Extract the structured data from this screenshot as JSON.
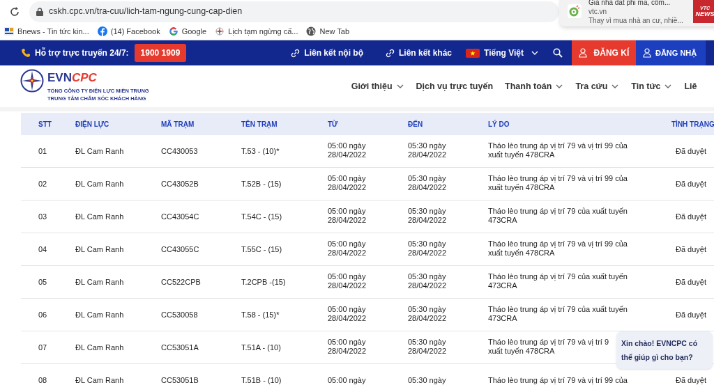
{
  "browser": {
    "url": "cskh.cpc.vn/tra-cuu/lich-tam-ngung-cung-cap-dien",
    "bookmarks": [
      {
        "kind": "bnews",
        "label": "Bnews - Tin tức kin..."
      },
      {
        "kind": "facebook",
        "label": "(14) Facebook"
      },
      {
        "kind": "google",
        "label": "Google"
      },
      {
        "kind": "evn",
        "label": "Lịch tạm ngừng cấ..."
      },
      {
        "kind": "globe",
        "label": "New Tab"
      }
    ],
    "notification": {
      "headline": "Giá nhà đất phi mã, côm...",
      "source": "vtc.vn",
      "snippet": "Thay vì mua nhà an cư, nhiề...",
      "logo_lines": [
        "VTC",
        "NEWS"
      ]
    }
  },
  "topbar": {
    "support_label": "Hỗ trợ trực truyến 24/7:",
    "hotline": "1900 1909",
    "links": [
      "Liên kết nội bộ",
      "Liên kết khác"
    ],
    "language": "Tiếng Việt",
    "register": "ĐĂNG KÍ",
    "login": "ĐĂNG NHẬ"
  },
  "header": {
    "logo": {
      "brand_a": "EVN",
      "brand_b": "CPC",
      "line1": "TỔNG CÔNG TY ĐIỆN LỰC MIỀN TRUNG",
      "line2": "TRUNG TÂM CHĂM SÓC KHÁCH HÀNG"
    },
    "nav": [
      {
        "label": "Giới thiệu",
        "dropdown": true
      },
      {
        "label": "Dịch vụ trực tuyến",
        "dropdown": false
      },
      {
        "label": "Thanh toán",
        "dropdown": true
      },
      {
        "label": "Tra cứu",
        "dropdown": true
      },
      {
        "label": "Tin tức",
        "dropdown": true
      },
      {
        "label": "Liê",
        "dropdown": false
      }
    ]
  },
  "table": {
    "columns": [
      "STT",
      "ĐIỆN LỰC",
      "MÃ TRẠM",
      "TÊN TRẠM",
      "TỪ",
      "ĐẾN",
      "LÝ DO",
      "TÌNH TRẠNG"
    ],
    "rows": [
      {
        "stt": "01",
        "unit": "ĐL Cam Ranh",
        "code": "CC430053",
        "name": "T.53 - (10)*",
        "from": [
          "05:00 ngày",
          "28/04/2022"
        ],
        "to": [
          "05:30 ngày",
          "28/04/2022"
        ],
        "reason": [
          "Tháo lèo trung áp vị trí 79 và vị trí 99 của",
          "xuất tuyến 478CRA"
        ],
        "status": "Đã duyệt"
      },
      {
        "stt": "02",
        "unit": "ĐL Cam Ranh",
        "code": "CC43052B",
        "name": "T.52B - (15)",
        "from": [
          "05:00 ngày",
          "28/04/2022"
        ],
        "to": [
          "05:30 ngày",
          "28/04/2022"
        ],
        "reason": [
          "Tháo lèo trung áp vị trí 79 và vị trí 99 của",
          "xuất tuyến 478CRA"
        ],
        "status": "Đã duyệt"
      },
      {
        "stt": "03",
        "unit": "ĐL Cam Ranh",
        "code": "CC43054C",
        "name": "T.54C - (15)",
        "from": [
          "05:00 ngày",
          "28/04/2022"
        ],
        "to": [
          "05:30 ngày",
          "28/04/2022"
        ],
        "reason": [
          "Tháo lèo trung áp vị trí 79 của xuất tuyến",
          "473CRA"
        ],
        "status": "Đã duyệt"
      },
      {
        "stt": "04",
        "unit": "ĐL Cam Ranh",
        "code": "CC43055C",
        "name": "T.55C - (15)",
        "from": [
          "05:00 ngày",
          "28/04/2022"
        ],
        "to": [
          "05:30 ngày",
          "28/04/2022"
        ],
        "reason": [
          "Tháo lèo trung áp vị trí 79 và vị trí 99 của",
          "xuất tuyến 478CRA"
        ],
        "status": "Đã duyệt"
      },
      {
        "stt": "05",
        "unit": "ĐL Cam Ranh",
        "code": "CC522CPB",
        "name": "T.2CPB -(15)",
        "from": [
          "05:00 ngày",
          "28/04/2022"
        ],
        "to": [
          "05:30 ngày",
          "28/04/2022"
        ],
        "reason": [
          "Tháo lèo trung áp vị trí 79 của xuất tuyến",
          "473CRA"
        ],
        "status": "Đã duyệt"
      },
      {
        "stt": "06",
        "unit": "ĐL Cam Ranh",
        "code": "CC530058",
        "name": "T.58 - (15)*",
        "from": [
          "05:00 ngày",
          "28/04/2022"
        ],
        "to": [
          "05:30 ngày",
          "28/04/2022"
        ],
        "reason": [
          "Tháo lèo trung áp vị trí 79 của xuất tuyến",
          "473CRA"
        ],
        "status": "Đã duyệt"
      },
      {
        "stt": "07",
        "unit": "ĐL Cam Ranh",
        "code": "CC53051A",
        "name": "T.51A - (10)",
        "from": [
          "05:00 ngày",
          "28/04/2022"
        ],
        "to": [
          "05:30 ngày",
          "28/04/2022"
        ],
        "reason": [
          "Tháo lèo trung áp vị trí 79 và vị trí 9",
          "xuất tuyến 478CRA"
        ]
      },
      {
        "stt": "08",
        "unit": "ĐL Cam Ranh",
        "code": "CC53051B",
        "name": "T.51B - (10)",
        "from": [
          "05:00 ngày"
        ],
        "to": [
          "05:30 ngày"
        ],
        "reason": [
          "Tháo lèo trung áp vị trí 79 và vị trí 99 của"
        ],
        "status": "Đã duyệt"
      }
    ]
  },
  "chat_bubble": {
    "text": "Xin chào! EVNCPC có thể giúp gì cho bạn?"
  }
}
